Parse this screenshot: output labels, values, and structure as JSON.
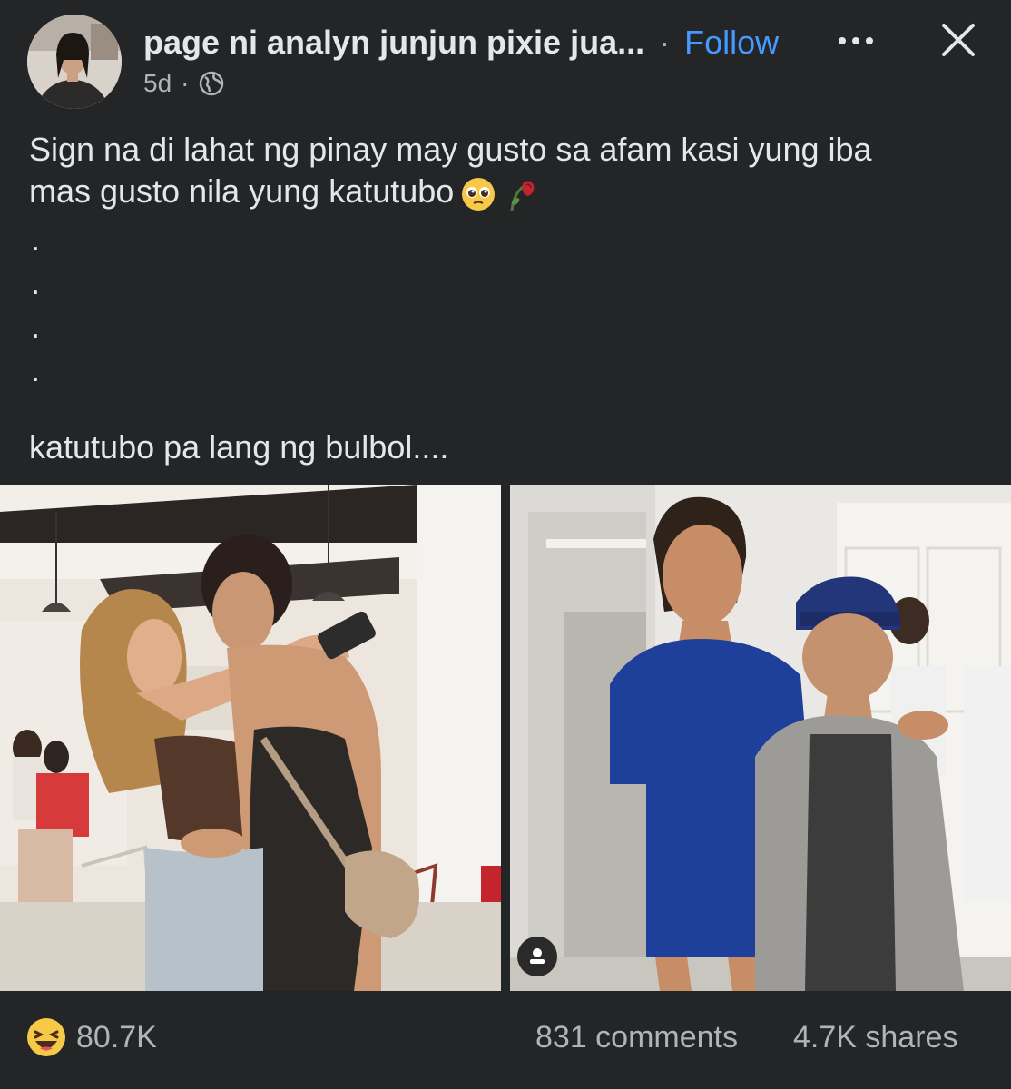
{
  "post": {
    "author": "page ni analyn junjun pixie jua...",
    "separator": "·",
    "follow_label": "Follow",
    "time": "5d",
    "meta_separator": "·",
    "privacy_icon": "globe-icon",
    "more_icon": "more-horizontal-icon",
    "close_icon": "close-icon",
    "text_lines": [
      "Sign na di lahat ng pinay may gusto sa afam kasi yung iba",
      "mas gusto nila yung katutubo"
    ],
    "text_emojis": [
      "pleading-face-emoji",
      "wilted-rose-emoji"
    ],
    "dots": [
      ".",
      ".",
      ".",
      "."
    ],
    "last_line": "katutubo pa lang ng bulbol....",
    "images": [
      {
        "name": "photo-couple-hugging"
      },
      {
        "name": "photo-volleyball-player-with-boy"
      }
    ]
  },
  "footer": {
    "reaction_icon": "haha-reaction-icon",
    "reaction_count": "80.7K",
    "comments": "831 comments",
    "shares": "4.7K shares"
  },
  "colors": {
    "background": "#242526",
    "text": "#e4e6eb",
    "secondary": "#b0b3b8",
    "follow": "#4599ff"
  }
}
